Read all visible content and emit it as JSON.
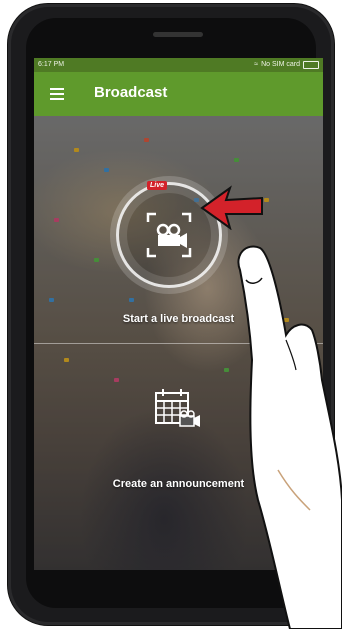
{
  "status_bar": {
    "time": "6:17 PM",
    "carrier": "No SIM card"
  },
  "app_bar": {
    "title": "Broadcast",
    "menu_icon": "hamburger-menu-icon"
  },
  "actions": {
    "live": {
      "badge": "Live",
      "label": "Start a live broadcast",
      "icon": "video-camera-icon"
    },
    "announcement": {
      "label": "Create an announcement",
      "icon": "calendar-video-icon"
    }
  },
  "colors": {
    "app_bar": "#5f9a2c",
    "status_bar": "#4f7a24",
    "live_badge": "#d3222a",
    "arrow": "#d3222a"
  }
}
